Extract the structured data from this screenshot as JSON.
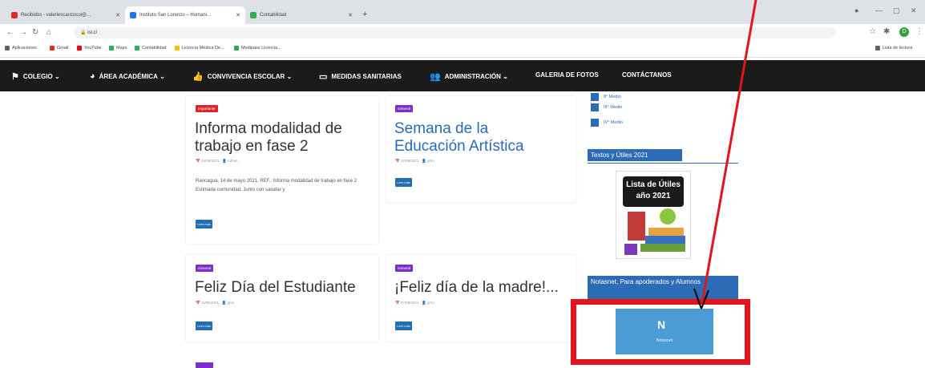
{
  "browser": {
    "tabs": [
      {
        "label": "Recibidos - valeriescanzocol@...",
        "active": false,
        "favcolor": "#d93025"
      },
      {
        "label": "Instituto San Lorenzo – Humani...",
        "active": true,
        "favcolor": "#1a73e8"
      },
      {
        "label": "Contabilidad",
        "active": false,
        "favcolor": "#34a853"
      }
    ],
    "new_tab": "+",
    "url": "isl.cl",
    "bookmarks": [
      "Aplicaciones",
      "Gmail",
      "YouTube",
      "Maps",
      "Contabilidad",
      "Licencia Médica De...",
      "Medipass Licencia..."
    ],
    "reading_list": "Lista de lectura",
    "profile_initial": "D"
  },
  "nav": {
    "items": [
      {
        "label": "COLEGIO",
        "caret": true,
        "icon": "flag-icon"
      },
      {
        "label": "ÁREA ACADÉMICA",
        "caret": true,
        "icon": "compass-icon"
      },
      {
        "label": "CONVIVENCIA ESCOLAR",
        "caret": true,
        "icon": "thumbs-up-icon"
      },
      {
        "label": "MEDIDAS SANITARIAS",
        "caret": false,
        "icon": "id-card-icon"
      },
      {
        "label": "ADMINISTRACIÓN",
        "caret": true,
        "icon": "people-icon"
      },
      {
        "label": "GALERIA DE FOTOS",
        "caret": false,
        "icon": ""
      },
      {
        "label": "CONTÁCTANOS",
        "caret": false,
        "icon": ""
      }
    ]
  },
  "posts": [
    {
      "badge": "Importante",
      "badge_color": "#d7262e",
      "title1": "Informa modalidad de",
      "title2": "trabajo en fase 2",
      "date": "14/05/2021",
      "author": "Admin",
      "excerpt": "Rancagua, 14 de mayo 2021. REF.: Informa modalidad de trabajo en fase 2 Estimada comunidad, Junto con saludar y",
      "button": "Leer más",
      "title_color": "#333333"
    },
    {
      "badge": "General",
      "badge_color": "#7b2ec8",
      "title1": "Semana de la",
      "title2": "Educación Artística",
      "date": "12/05/2021",
      "author": "gmo",
      "excerpt": "",
      "button": "Leer más",
      "title_color": "#2a6ab8"
    },
    {
      "badge": "General",
      "badge_color": "#7b2ec8",
      "title1": "Feliz Día del Estudiante",
      "title2": "",
      "date": "11/05/2021",
      "author": "gmo",
      "excerpt": "",
      "button": "Leer más",
      "title_color": "#333333"
    },
    {
      "badge": "General",
      "badge_color": "#7b2ec8",
      "title1": "¡Feliz día de la madre!...",
      "title2": "",
      "date": "07/05/2021",
      "author": "gmo",
      "excerpt": "",
      "button": "Leer más",
      "title_color": "#333333"
    }
  ],
  "sidebar": {
    "links": [
      "8° Medio",
      "III° Medio",
      "IV° Medio"
    ],
    "utiles_title": "Textos y Útiles 2021",
    "poster_line1": "Lista de Útiles",
    "poster_line2": "año 2021",
    "notas_title": "Notasnet, Para apoderados y Alumnos",
    "notas_logo_letter": "N",
    "notas_logo_label": "Notasnet"
  }
}
